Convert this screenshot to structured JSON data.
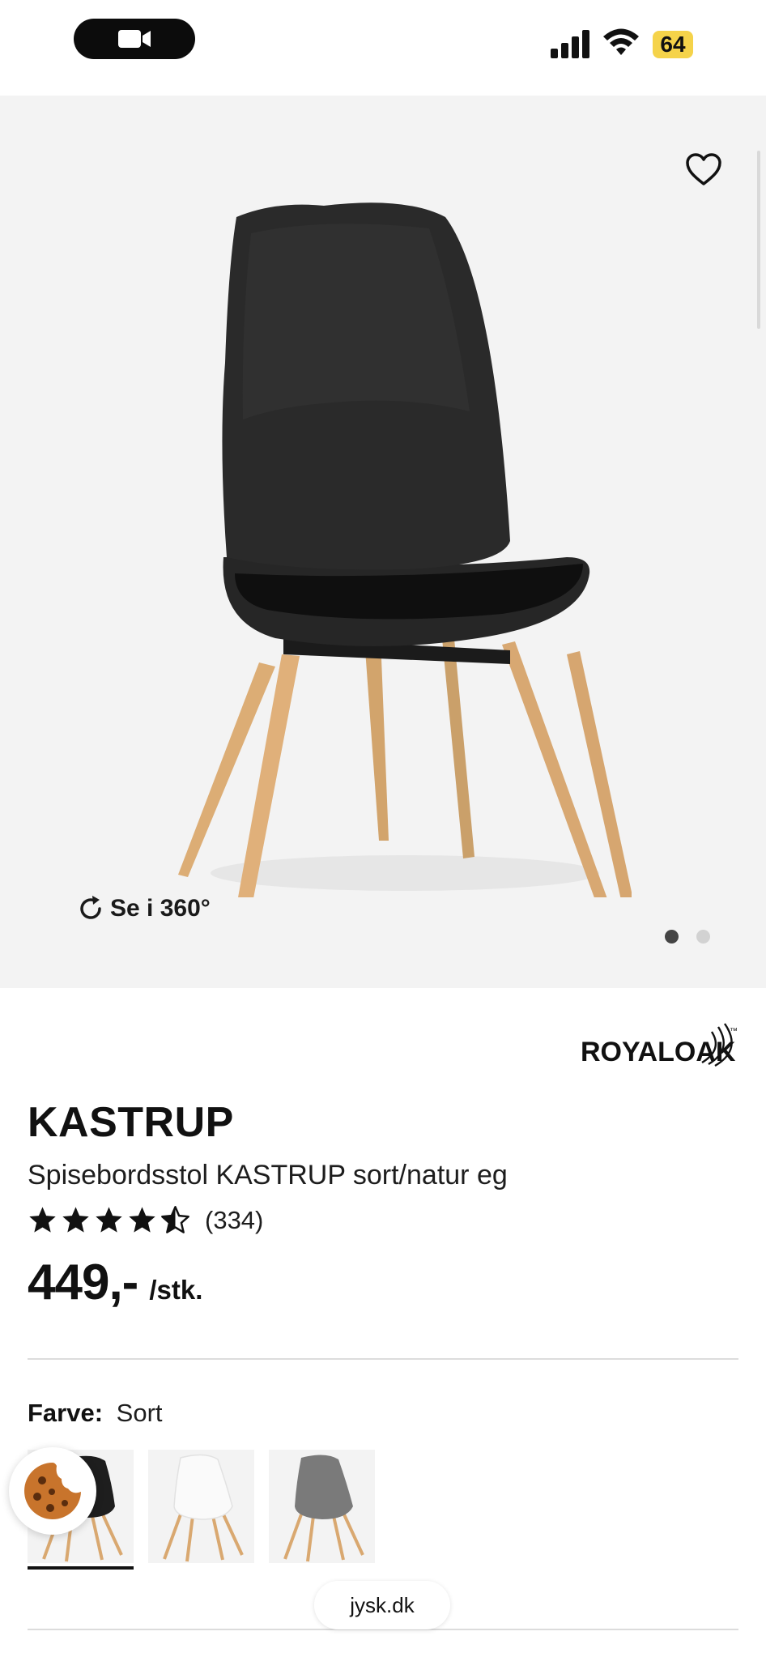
{
  "status_bar": {
    "battery": "64",
    "recording_icon": "video-camera-icon",
    "signal_icon": "cellular-signal-icon",
    "wifi_icon": "wifi-icon"
  },
  "gallery": {
    "spin_label": "Se i 360°",
    "favorite_icon": "heart-outline-icon",
    "pages": 2,
    "active_page": 1
  },
  "product": {
    "brand": "ROYALOAK",
    "brand_tm": "™",
    "name": "KASTRUP",
    "description": "Spisebordsstol KASTRUP sort/natur eg",
    "rating_value": 4.5,
    "rating_max": 5,
    "rating_count": "(334)",
    "price": "449,-",
    "price_unit": "/stk."
  },
  "color_option": {
    "label": "Farve:",
    "value": "Sort",
    "variants": [
      "black",
      "white",
      "grey"
    ],
    "selected": 0
  },
  "overlays": {
    "cookie_icon": "cookie-icon",
    "url": "jysk.dk"
  },
  "colors": {
    "gallery_bg": "#f3f3f3",
    "battery": "#f5d34a",
    "text": "#111111",
    "wood": "#d9a870"
  }
}
